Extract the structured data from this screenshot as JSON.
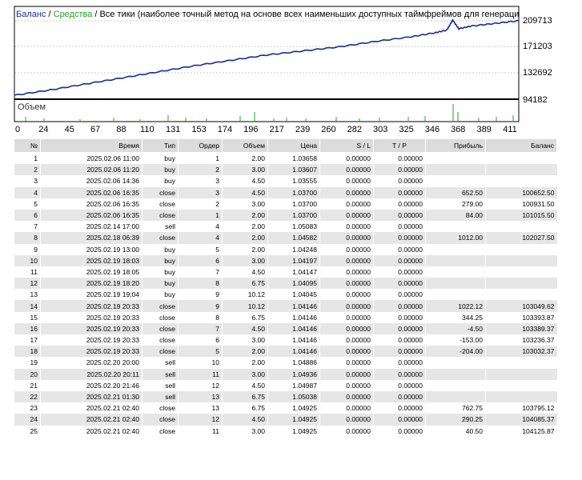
{
  "chart": {
    "title_balance": "Баланс",
    "sep1": " / ",
    "title_equity": "Средства",
    "sep2": " / ",
    "title_rest": "Все тики (наиболее точный метод на основе всех наименьших доступных таймфреймов для генерации каждого тика)",
    "volume_label": "Объем",
    "y_ticks": [
      "209713",
      "171203",
      "132692",
      "94182"
    ],
    "x_ticks": [
      "0",
      "24",
      "45",
      "67",
      "88",
      "110",
      "131",
      "153",
      "174",
      "196",
      "217",
      "239",
      "260",
      "282",
      "303",
      "325",
      "346",
      "368",
      "389",
      "411"
    ],
    "colors": {
      "balance": "#1a2fa0",
      "equity": "#1fa51f",
      "volume": "#1fa51f"
    }
  },
  "chart_data": {
    "type": "line",
    "y_range": [
      94182,
      209713
    ],
    "x_range": [
      0,
      420
    ],
    "series": [
      {
        "name": "Баланс",
        "x": [
          0,
          30,
          60,
          90,
          120,
          150,
          180,
          210,
          240,
          270,
          300,
          330,
          350,
          360,
          365,
          370,
          380,
          400,
          420
        ],
        "y": [
          100000,
          108000,
          117000,
          126000,
          135000,
          144000,
          152000,
          160000,
          166000,
          172000,
          180000,
          187000,
          193000,
          197000,
          212000,
          199000,
          203000,
          207000,
          211000
        ]
      }
    ],
    "grid": true
  },
  "table": {
    "headers": [
      "№",
      "Время",
      "Тип",
      "Ордер",
      "Объем",
      "Цена",
      "S / L",
      "T / P",
      "Прибыль",
      "Баланс"
    ],
    "rows": [
      [
        "1",
        "2025.02.06 11:00",
        "buy",
        "1",
        "2.00",
        "1.03658",
        "0.00000",
        "0.00000",
        "",
        ""
      ],
      [
        "2",
        "2025.02.06 11:20",
        "buy",
        "2",
        "3.00",
        "1.03607",
        "0.00000",
        "0.00000",
        "",
        ""
      ],
      [
        "3",
        "2025.02.06 14:36",
        "buy",
        "3",
        "4.50",
        "1.03555",
        "0.00000",
        "0.00000",
        "",
        ""
      ],
      [
        "4",
        "2025.02.06 16:35",
        "close",
        "3",
        "4.50",
        "1.03700",
        "0.00000",
        "0.00000",
        "652.50",
        "100652.50"
      ],
      [
        "5",
        "2025.02.06 16:35",
        "close",
        "2",
        "3.00",
        "1.03700",
        "0.00000",
        "0.00000",
        "279.00",
        "100931.50"
      ],
      [
        "6",
        "2025.02.06 16:35",
        "close",
        "1",
        "2.00",
        "1.03700",
        "0.00000",
        "0.00000",
        "84.00",
        "101015.50"
      ],
      [
        "7",
        "2025.02.14 17:00",
        "sell",
        "4",
        "2.00",
        "1.05083",
        "0.00000",
        "0.00000",
        "",
        ""
      ],
      [
        "8",
        "2025.02.18 06:39",
        "close",
        "4",
        "2.00",
        "1.04582",
        "0.00000",
        "0.00000",
        "1012.00",
        "102027.50"
      ],
      [
        "9",
        "2025.02.19 13:00",
        "buy",
        "5",
        "2.00",
        "1.04248",
        "0.00000",
        "0.00000",
        "",
        ""
      ],
      [
        "10",
        "2025.02.19 18:03",
        "buy",
        "6",
        "3.00",
        "1.04197",
        "0.00000",
        "0.00000",
        "",
        ""
      ],
      [
        "11",
        "2025.02.19 18:05",
        "buy",
        "7",
        "4.50",
        "1.04147",
        "0.00000",
        "0.00000",
        "",
        ""
      ],
      [
        "12",
        "2025.02.19 18:20",
        "buy",
        "8",
        "6.75",
        "1.04095",
        "0.00000",
        "0.00000",
        "",
        ""
      ],
      [
        "13",
        "2025.02.19 19:04",
        "buy",
        "9",
        "10.12",
        "1.04045",
        "0.00000",
        "0.00000",
        "",
        ""
      ],
      [
        "14",
        "2025.02.19 20:33",
        "close",
        "9",
        "10.12",
        "1.04146",
        "0.00000",
        "0.00000",
        "1022.12",
        "103049.62"
      ],
      [
        "15",
        "2025.02.19 20:33",
        "close",
        "8",
        "6.75",
        "1.04146",
        "0.00000",
        "0.00000",
        "344.25",
        "103393.87"
      ],
      [
        "16",
        "2025.02.19 20:33",
        "close",
        "7",
        "4.50",
        "1.04146",
        "0.00000",
        "0.00000",
        "-4.50",
        "103389.37"
      ],
      [
        "17",
        "2025.02.19 20:33",
        "close",
        "6",
        "3.00",
        "1.04146",
        "0.00000",
        "0.00000",
        "-153.00",
        "103236.37"
      ],
      [
        "18",
        "2025.02.19 20:33",
        "close",
        "5",
        "2.00",
        "1.04146",
        "0.00000",
        "0.00000",
        "-204.00",
        "103032.37"
      ],
      [
        "19",
        "2025.02.20 20:00",
        "sell",
        "10",
        "2.00",
        "1.04886",
        "0.00000",
        "0.00000",
        "",
        ""
      ],
      [
        "20",
        "2025.02.20 20:11",
        "sell",
        "11",
        "3.00",
        "1.04936",
        "0.00000",
        "0.00000",
        "",
        ""
      ],
      [
        "21",
        "2025.02.20 21:46",
        "sell",
        "12",
        "4.50",
        "1.04987",
        "0.00000",
        "0.00000",
        "",
        ""
      ],
      [
        "22",
        "2025.02.21 01:30",
        "sell",
        "13",
        "6.75",
        "1.05038",
        "0.00000",
        "0.00000",
        "",
        ""
      ],
      [
        "23",
        "2025.02.21 02:40",
        "close",
        "13",
        "6.75",
        "1.04925",
        "0.00000",
        "0.00000",
        "762.75",
        "103795.12"
      ],
      [
        "24",
        "2025.02.21 02:40",
        "close",
        "12",
        "4.50",
        "1.04925",
        "0.00000",
        "0.00000",
        "290.25",
        "104085.37"
      ],
      [
        "25",
        "2025.02.21 02:40",
        "close",
        "11",
        "3.00",
        "1.04925",
        "0.00000",
        "0.00000",
        "40.50",
        "104125.87"
      ]
    ]
  }
}
